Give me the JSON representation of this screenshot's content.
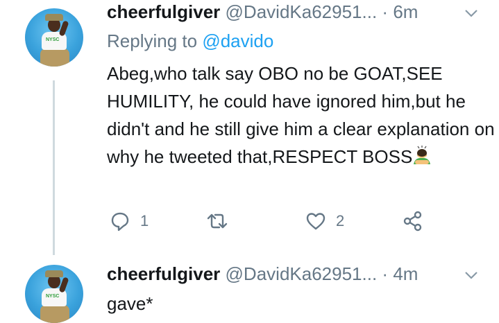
{
  "tweets": [
    {
      "display_name": "cheerfulgiver",
      "handle": "@DavidKa62951...",
      "time": "6m",
      "reply_prefix": "Replying to",
      "reply_mention": "@davido",
      "text": "Abeg,who talk say OBO no be GOAT,SEE HUMILITY, he could have ignored him,but he didn't and he still give him a clear explanation on why he tweeted that,RESPECT BOSS",
      "emoji": "person-bowing-emoji",
      "actions": {
        "reply_count": "1",
        "retweet_count": "",
        "like_count": "2"
      }
    },
    {
      "display_name": "cheerfulgiver",
      "handle": "@DavidKa62951...",
      "time": "4m",
      "text": "gave*"
    }
  ],
  "colors": {
    "text": "#14171a",
    "muted": "#657786",
    "link": "#1da1f2",
    "thread_line": "#cfd9de"
  }
}
